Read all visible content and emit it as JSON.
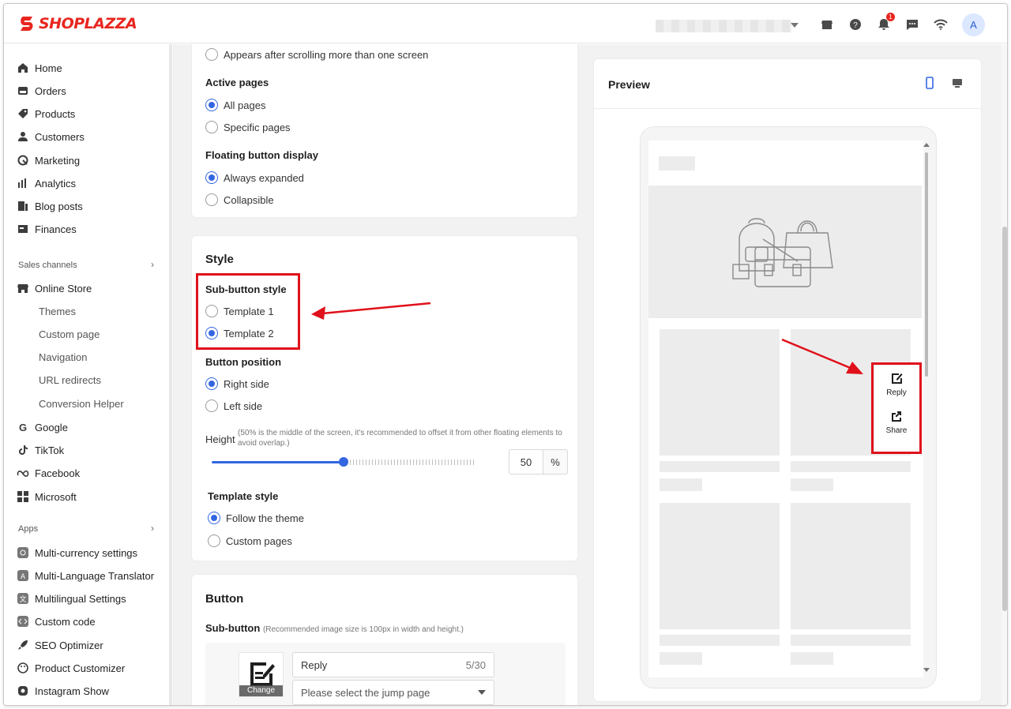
{
  "brand": {
    "name": "SHOPLAZZA",
    "color": "#e8261f"
  },
  "topbar": {
    "notification_count": "1",
    "avatar_letter": "A"
  },
  "sidebar": {
    "main_items": [
      {
        "label": "Home",
        "icon": "home-icon"
      },
      {
        "label": "Orders",
        "icon": "orders-icon"
      },
      {
        "label": "Products",
        "icon": "products-icon"
      },
      {
        "label": "Customers",
        "icon": "customers-icon"
      },
      {
        "label": "Marketing",
        "icon": "marketing-icon"
      },
      {
        "label": "Analytics",
        "icon": "analytics-icon"
      },
      {
        "label": "Blog posts",
        "icon": "blog-icon"
      },
      {
        "label": "Finances",
        "icon": "finances-icon"
      }
    ],
    "sales_channels_label": "Sales channels",
    "online_store": "Online Store",
    "online_store_sub": [
      "Themes",
      "Custom page",
      "Navigation",
      "URL redirects",
      "Conversion Helper"
    ],
    "channels": [
      "Google",
      "TikTok",
      "Facebook",
      "Microsoft"
    ],
    "apps_label": "Apps",
    "apps": [
      "Multi-currency settings",
      "Multi-Language Translator",
      "Multilingual Settings",
      "Custom code",
      "SEO Optimizer",
      "Product Customizer",
      "Instagram Show"
    ]
  },
  "display_card": {
    "scroll_option": "Appears after scrolling more than one screen",
    "active_pages_label": "Active pages",
    "active_pages_options": [
      "All pages",
      "Specific pages"
    ],
    "floating_label": "Floating button display",
    "floating_options": [
      "Always expanded",
      "Collapsible"
    ]
  },
  "style_card": {
    "title": "Style",
    "sub_button_style_label": "Sub-button style",
    "sub_button_options": [
      "Template 1",
      "Template 2"
    ],
    "button_position_label": "Button position",
    "position_options": [
      "Right side",
      "Left side"
    ],
    "height_label": "Height",
    "height_hint": "(50% is the middle of the screen, it's recommended to offset it from other floating elements to avoid overlap.)",
    "height_value": "50",
    "height_unit": "%",
    "slider_fraction": 0.5,
    "template_style_label": "Template style",
    "template_style_options": [
      "Follow the theme",
      "Custom pages"
    ]
  },
  "button_card": {
    "title": "Button",
    "sub_button_label": "Sub-button",
    "sub_button_hint": "(Recommended image size is 100px in width and height.)",
    "change_label": "Change",
    "name_value": "Reply",
    "name_count": "5/30",
    "jump_placeholder": "Please select the jump page"
  },
  "preview": {
    "title": "Preview",
    "floating_buttons": [
      {
        "label": "Reply",
        "icon": "reply-icon"
      },
      {
        "label": "Share",
        "icon": "share-icon"
      }
    ]
  },
  "colors": {
    "accent": "#3366e0",
    "highlight": "#e0111b"
  }
}
